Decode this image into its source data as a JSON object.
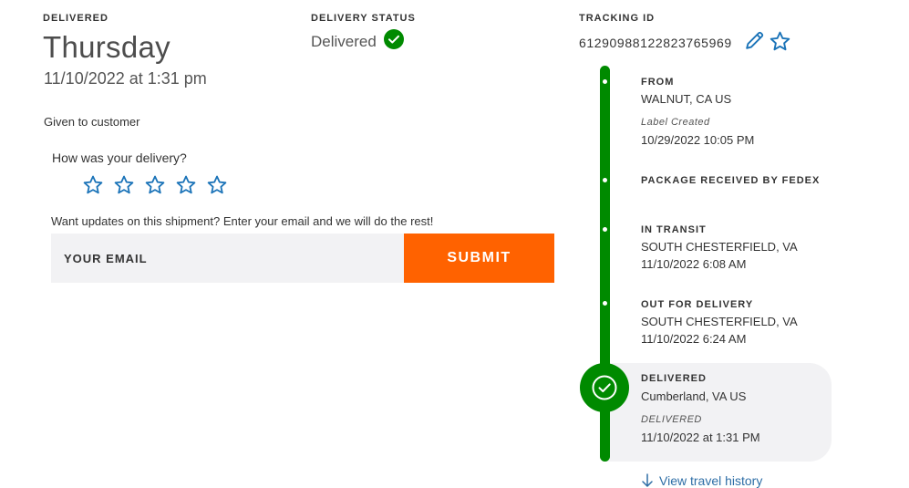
{
  "delivery": {
    "label": "DELIVERED",
    "day": "Thursday",
    "datetime": "11/10/2022 at 1:31 pm",
    "given_to": "Given to customer"
  },
  "status": {
    "label": "DELIVERY STATUS",
    "value": "Delivered",
    "icon": "check-circle-icon",
    "color": "#008a00"
  },
  "tracking": {
    "label": "TRACKING ID",
    "number": "612909881228237659​69",
    "edit_icon": "pencil-icon",
    "favorite_icon": "star-outline-icon"
  },
  "rating": {
    "question": "How was your delivery?",
    "max_stars": 5,
    "selected": 0
  },
  "updates": {
    "prompt": "Want updates on this shipment? Enter your email and we will do the rest!",
    "email_placeholder": "YOUR EMAIL",
    "submit_label": "SUBMIT",
    "submit_color": "#ff6200"
  },
  "timeline": {
    "color": "#008a00",
    "events": [
      {
        "title": "FROM",
        "line1": "WALNUT, CA US",
        "note": "Label Created",
        "time": "10/29/2022 10:05 PM"
      },
      {
        "title": "PACKAGE RECEIVED BY FEDEX"
      },
      {
        "title": "IN TRANSIT",
        "line1": "SOUTH CHESTERFIELD, VA",
        "time": "11/10/2022 6:08 AM"
      },
      {
        "title": "OUT FOR DELIVERY",
        "line1": "SOUTH CHESTERFIELD, VA",
        "time": "11/10/2022 6:24 AM"
      },
      {
        "title": "DELIVERED",
        "line1": "Cumberland, VA US",
        "note": "DELIVERED",
        "time": "11/10/2022 at 1:31 PM"
      }
    ],
    "view_history": "View travel history"
  }
}
